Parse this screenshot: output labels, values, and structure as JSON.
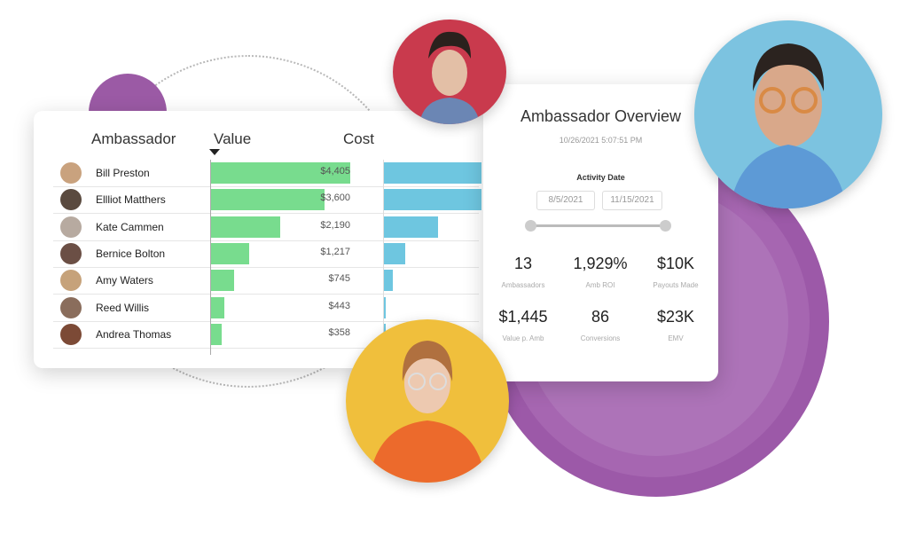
{
  "table": {
    "headers": {
      "ambassador": "Ambassador",
      "value": "Value",
      "cost": "Cost"
    },
    "rows": [
      {
        "name": "Bill Preston",
        "value": 4405,
        "value_label": "$4,405",
        "cost_fraction": 1.0,
        "avatar_color": "#c9a27e"
      },
      {
        "name": "Ellliot Matthers",
        "value": 3600,
        "value_label": "$3,600",
        "cost_fraction": 1.0,
        "avatar_color": "#5a4a3f"
      },
      {
        "name": "Kate Cammen",
        "value": 2190,
        "value_label": "$2,190",
        "cost_fraction": 0.55,
        "avatar_color": "#b7aaa0"
      },
      {
        "name": "Bernice Bolton",
        "value": 1217,
        "value_label": "$1,217",
        "cost_fraction": 0.22,
        "avatar_color": "#6b4f45"
      },
      {
        "name": "Amy Waters",
        "value": 745,
        "value_label": "$745",
        "cost_fraction": 0.09,
        "avatar_color": "#c6a27a"
      },
      {
        "name": "Reed Willis",
        "value": 443,
        "value_label": "$443",
        "cost_fraction": 0.02,
        "avatar_color": "#8a6d5c"
      },
      {
        "name": "Andrea Thomas",
        "value": 358,
        "value_label": "$358",
        "cost_fraction": 0.02,
        "avatar_color": "#7c4a36"
      }
    ],
    "value_max": 4405,
    "colors": {
      "value_bar": "#78dc8e",
      "cost_bar": "#6ec6e0"
    }
  },
  "overview": {
    "title": "Ambassador Overview",
    "timestamp": "10/26/2021  5:07:51 PM",
    "activity_date_label": "Activity Date",
    "start_date": "8/5/2021",
    "end_date": "11/15/2021",
    "kpis": [
      {
        "value": "13",
        "label": "Ambassadors"
      },
      {
        "value": "1,929%",
        "label": "Amb ROI"
      },
      {
        "value": "$10K",
        "label": "Payouts Made"
      },
      {
        "value": "$1,445",
        "label": "Value p. Amb"
      },
      {
        "value": "86",
        "label": "Conversions"
      },
      {
        "value": "$23K",
        "label": "EMV"
      }
    ]
  },
  "portraits": [
    {
      "name": "man-red-background",
      "color": "#c93a4d"
    },
    {
      "name": "man-glasses-blue-background",
      "color": "#7cc3e0"
    },
    {
      "name": "woman-yellow-background",
      "color": "#f0bf3c"
    }
  ]
}
